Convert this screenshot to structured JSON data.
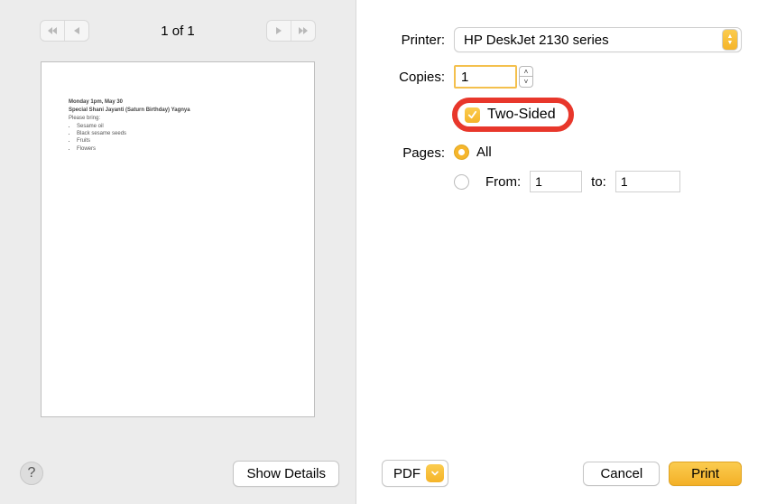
{
  "pager": {
    "label": "1 of 1"
  },
  "preview": {
    "line1": "Monday 1pm, May 30",
    "line2": "Special Shani Jayanti (Saturn Birthday) Yagnya",
    "line3": "Please bring:",
    "items": [
      "Sesame oil",
      "Black sesame seeds",
      "Fruits",
      "Flowers"
    ]
  },
  "help": {
    "glyph": "?"
  },
  "show_details": "Show Details",
  "printer": {
    "label": "Printer:",
    "value": "HP DeskJet 2130 series"
  },
  "copies": {
    "label": "Copies:",
    "value": "1"
  },
  "two_sided": {
    "label": "Two-Sided",
    "checked": true
  },
  "pages": {
    "label": "Pages:",
    "all": "All",
    "from": "From:",
    "from_value": "1",
    "to": "to:",
    "to_value": "1"
  },
  "pdf": {
    "label": "PDF"
  },
  "cancel": "Cancel",
  "print": "Print"
}
